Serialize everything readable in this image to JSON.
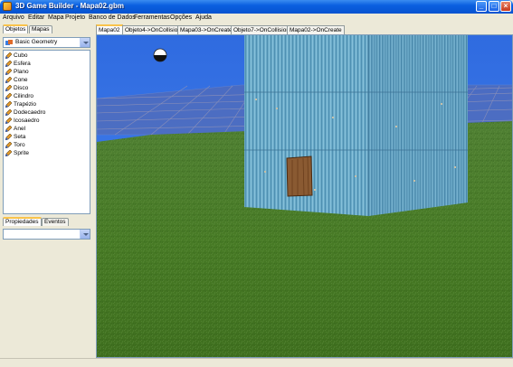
{
  "window": {
    "title": "3D Game Builder - Mapa02.gbm",
    "buttons": {
      "minimize": "_",
      "maximize": "□",
      "close": "×"
    }
  },
  "menu": [
    "Arquivo",
    "Editar",
    "Mapa",
    "Projeto",
    "Banco de Dados",
    "Ferramentas",
    "Opções",
    "Ajuda"
  ],
  "left_panel": {
    "top_tabs": [
      "Objetos",
      "Mapas"
    ],
    "category": "Basic Geometry",
    "objects": [
      "Cubo",
      "Esfera",
      "Plano",
      "Cone",
      "Disco",
      "Cilindro",
      "Trapézio",
      "Dodecaedro",
      "Icosaedro",
      "Anel",
      "Seta",
      "Toro",
      "Sprite"
    ],
    "bottom_tabs": [
      "Propiedades",
      "Eventos"
    ],
    "property_select": ""
  },
  "viewport": {
    "tabs": [
      "Mapa02",
      "Objeto4->OnCollision",
      "Mapa03->OnCreate",
      "Objeto7->OnCollision",
      "Mapa02->OnCreate"
    ],
    "active_tab": "Mapa02",
    "colors": {
      "sky": "#3a72e0",
      "ground": "#4a7d2a",
      "building": "#6aa8c6",
      "grid": "#7a7fae"
    }
  }
}
